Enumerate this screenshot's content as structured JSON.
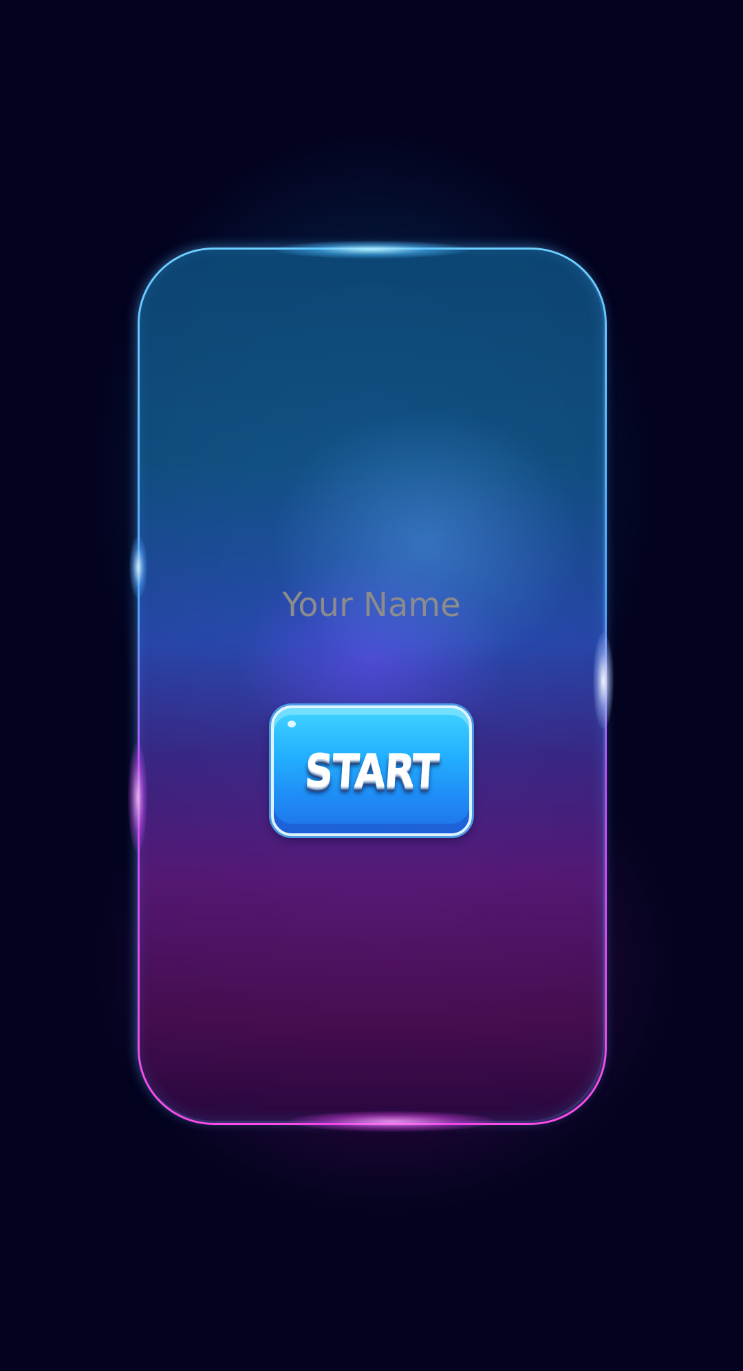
{
  "name_field": {
    "placeholder": "Your Name",
    "value": ""
  },
  "start_button": {
    "label": "START"
  },
  "colors": {
    "background": "#03031f",
    "frame_top": "#6fd0ff",
    "frame_bottom": "#ff4be8",
    "button_face": "#23b0ff",
    "button_border": "#dff4ff",
    "placeholder_text": "#8c8c8c"
  }
}
